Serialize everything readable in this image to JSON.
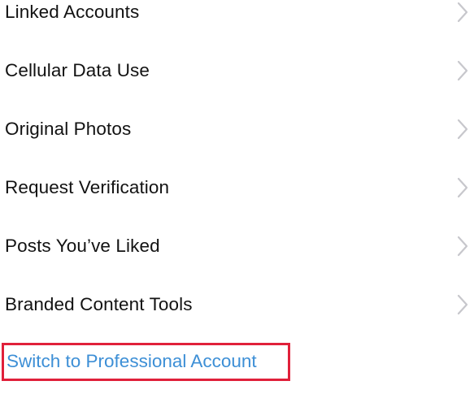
{
  "settings": {
    "items": [
      {
        "label": "Linked Accounts"
      },
      {
        "label": "Cellular Data Use"
      },
      {
        "label": "Original Photos"
      },
      {
        "label": "Request Verification"
      },
      {
        "label": "Posts You’ve Liked"
      },
      {
        "label": "Branded Content Tools"
      }
    ],
    "professional_link": "Switch to Professional Account"
  },
  "colors": {
    "text": "#121212",
    "chevron": "#c7c7cc",
    "link": "#3d8fd6",
    "highlight_border": "#e0203a"
  }
}
